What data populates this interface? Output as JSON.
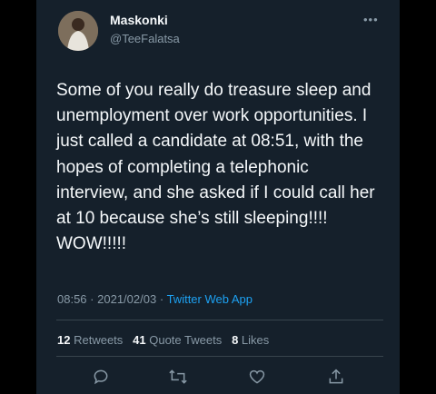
{
  "user": {
    "display_name": "Maskonki",
    "handle": "@TeeFalatsa",
    "avatar_icon": "profile-photo"
  },
  "tweet": {
    "text": "Some of you really do treasure sleep and unemployment over work opportunities. I just called a candidate at 08:51, with the hopes of completing a telephonic interview, and she asked if I could call her at 10 because she’s still sleeping!!!! WOW!!!!!",
    "time": "08:56",
    "date": "2021/02/03",
    "separator": "·",
    "source": "Twitter Web App"
  },
  "stats": {
    "retweets_count": "12",
    "retweets_label": "Retweets",
    "quotes_count": "41",
    "quotes_label": "Quote Tweets",
    "likes_count": "8",
    "likes_label": "Likes"
  },
  "actions": {
    "reply_icon": "reply-icon",
    "retweet_icon": "retweet-icon",
    "like_icon": "heart-icon",
    "share_icon": "share-icon"
  },
  "colors": {
    "background": "#15202b",
    "text": "#f5f8fa",
    "muted": "#8899a6",
    "accent": "#1da1f2",
    "divider": "#38444d"
  }
}
